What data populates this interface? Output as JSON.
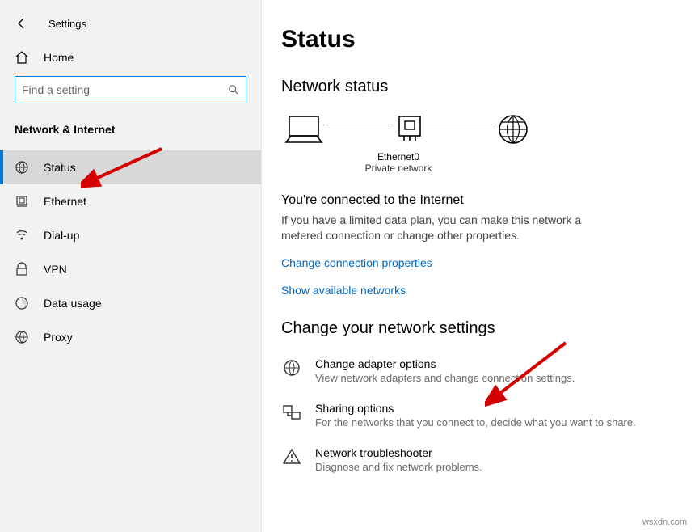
{
  "app_title": "Settings",
  "home_label": "Home",
  "search": {
    "placeholder": "Find a setting"
  },
  "category": "Network & Internet",
  "nav": [
    {
      "label": "Status"
    },
    {
      "label": "Ethernet"
    },
    {
      "label": "Dial-up"
    },
    {
      "label": "VPN"
    },
    {
      "label": "Data usage"
    },
    {
      "label": "Proxy"
    }
  ],
  "page": {
    "title": "Status",
    "section1_title": "Network status",
    "diagram": {
      "name": "Ethernet0",
      "type": "Private network"
    },
    "connected_title": "You're connected to the Internet",
    "connected_desc": "If you have a limited data plan, you can make this network a metered connection or change other properties.",
    "link_change_props": "Change connection properties",
    "link_show_networks": "Show available networks",
    "section2_title": "Change your network settings",
    "settings": [
      {
        "label": "Change adapter options",
        "desc": "View network adapters and change connection settings."
      },
      {
        "label": "Sharing options",
        "desc": "For the networks that you connect to, decide what you want to share."
      },
      {
        "label": "Network troubleshooter",
        "desc": "Diagnose and fix network problems."
      }
    ]
  },
  "watermark": "wsxdn.com"
}
